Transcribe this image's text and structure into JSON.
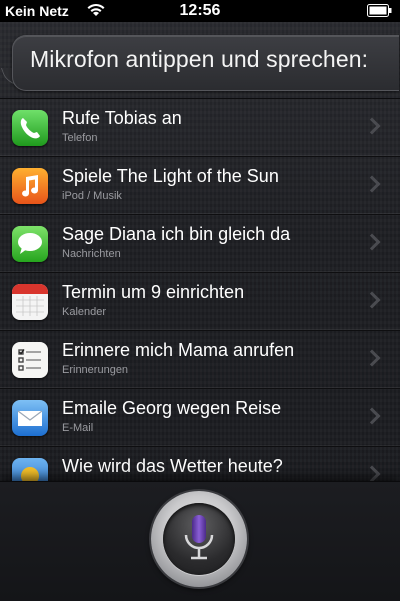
{
  "status_bar": {
    "carrier": "Kein Netz",
    "time": "12:56",
    "wifi_icon": "wifi-icon",
    "battery_icon": "battery-icon"
  },
  "prompt": {
    "text": "Mikrofon antippen und sprechen:"
  },
  "suggestions": [
    {
      "title": "Rufe Tobias an",
      "subtitle": "Telefon",
      "icon": "phone-icon"
    },
    {
      "title": "Spiele The Light of the Sun",
      "subtitle": "iPod / Musik",
      "icon": "music-icon"
    },
    {
      "title": "Sage Diana ich bin gleich da",
      "subtitle": "Nachrichten",
      "icon": "messages-icon"
    },
    {
      "title": "Termin um 9 einrichten",
      "subtitle": "Kalender",
      "icon": "calendar-icon"
    },
    {
      "title": "Erinnere mich Mama anrufen",
      "subtitle": "Erinnerungen",
      "icon": "reminders-icon"
    },
    {
      "title": "Emaile Georg wegen Reise",
      "subtitle": "E-Mail",
      "icon": "mail-icon"
    },
    {
      "title": "Wie wird das Wetter heute?",
      "subtitle": "",
      "icon": "weather-icon"
    }
  ],
  "colors": {
    "accent_mic": "#6a3fb5",
    "background": "#1f2024",
    "subtitle": "#9a9ba0"
  },
  "mic_button": {
    "icon": "microphone-icon"
  }
}
